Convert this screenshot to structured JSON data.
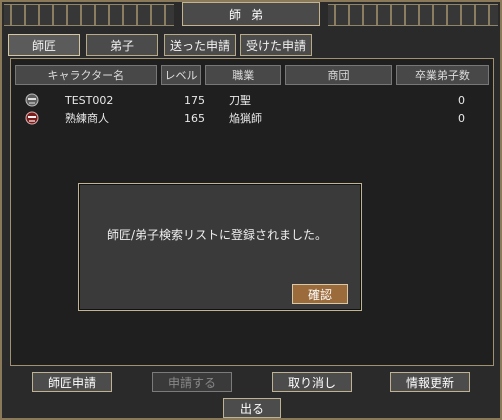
{
  "window": {
    "title": "師弟"
  },
  "tabs": [
    {
      "label": "師匠"
    },
    {
      "label": "弟子"
    },
    {
      "label": "送った申請"
    },
    {
      "label": "受けた申請"
    }
  ],
  "table": {
    "headers": [
      "キャラクター名",
      "レベル",
      "職業",
      "商団",
      "卒業弟子数"
    ],
    "rows": [
      {
        "name": "TEST002",
        "level": "175",
        "job": "刀聖",
        "guild": "",
        "graduates": "0"
      },
      {
        "name": "熟練商人",
        "level": "165",
        "job": "焔猟師",
        "guild": "",
        "graduates": "0"
      }
    ]
  },
  "modal": {
    "message": "師匠/弟子検索リストに登録されました。",
    "ok_label": "確認"
  },
  "buttons": {
    "apply_mentor": "師匠申請",
    "apply": "申請する",
    "cancel": "取り消し",
    "refresh": "情報更新",
    "exit": "出る"
  },
  "colors": {
    "accent_button": "#9c6b3b",
    "frame_border": "#8a7a5a"
  },
  "icons": {
    "row_avatar_1": "character-avatar-icon",
    "row_avatar_2": "character-avatar-icon"
  }
}
